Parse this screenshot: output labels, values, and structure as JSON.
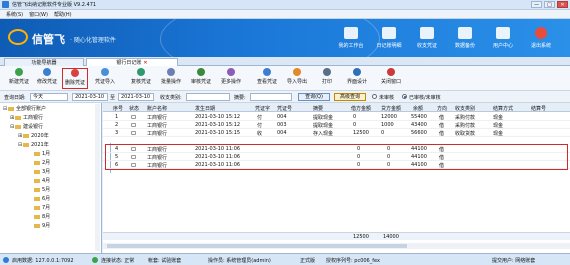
{
  "window": {
    "title": "信管飞出纳记账软件专业版 V9.2.471",
    "btn_min": "—",
    "btn_max": "□",
    "btn_close": "✕"
  },
  "menu": [
    "系统(S)",
    "窗口(W)",
    "帮助(H)"
  ],
  "banner": {
    "brand": "信管飞",
    "slogan": "· 随心化管理软件",
    "buttons": [
      {
        "label": "我的工作台",
        "icon": "desk-icon"
      },
      {
        "label": "日记账明细",
        "icon": "ledger-icon"
      },
      {
        "label": "收支凭证",
        "icon": "voucher-icon"
      },
      {
        "label": "数据备份",
        "icon": "backup-icon"
      },
      {
        "label": "用户中心",
        "icon": "user-icon"
      },
      {
        "label": "退出系统",
        "icon": "exit-icon"
      }
    ]
  },
  "tabs": [
    {
      "label": "功能导航器"
    },
    {
      "label": "银行日记账",
      "close": "✕"
    }
  ],
  "toolbar": [
    {
      "label": "新建凭证",
      "color": "#3aa24a"
    },
    {
      "label": "修改凭证",
      "color": "#3a7fd0"
    },
    {
      "label": "删除凭证",
      "color": "#d94040"
    },
    {
      "label": "凭证导入",
      "color": "#4a90d9"
    },
    {
      "label": "复核凭证",
      "color": "#2d9b6d"
    },
    {
      "label": "批量操作",
      "color": "#6d7fb0"
    },
    {
      "label": "审核凭证",
      "color": "#3a8a3a"
    },
    {
      "label": "更多操作",
      "color": "#8b5cb8"
    },
    {
      "label": "查看凭证",
      "color": "#3a7fd0"
    },
    {
      "label": "导入导出",
      "color": "#e08a2a"
    },
    {
      "label": "打印",
      "color": "#5a6e86"
    },
    {
      "label": "界面设计",
      "color": "#2f6fba"
    },
    {
      "label": "关闭窗口",
      "color": "#c93a3a"
    }
  ],
  "filter": {
    "period_label": "查询日期:",
    "period_value": "今天",
    "date_from": "2021-03-10",
    "date_sep": "至",
    "date_to": "2021-03-10",
    "category_label": "收支类别:",
    "category_value": "",
    "summary_label": "摘要:",
    "summary_value": "",
    "query_btn": "查询(Q)",
    "advanced_btn": "高级查询",
    "radio_unreviewed": "未审核",
    "radio_all": "已审核/未审核"
  },
  "tree": {
    "root": "全部银行账户",
    "bank1": "工商银行",
    "bank2": "建设银行",
    "y2020": "2020年",
    "y2021": "2021年",
    "months": [
      "1月",
      "2月",
      "3月",
      "4月",
      "5月",
      "6月",
      "7月",
      "8月",
      "9月"
    ]
  },
  "grid": {
    "headers": [
      "序号",
      "状态",
      "账户名称",
      "发生日期",
      "凭证字",
      "凭证号",
      "摘要",
      "借方金额",
      "贷方金额",
      "余额",
      "方向",
      "收支类别",
      "结算方式",
      "结算号"
    ],
    "rows": [
      [
        "1",
        "",
        "工商银行",
        "2021-03-10 15:12",
        "付",
        "004",
        "提取现金",
        "0",
        "12000",
        "55400",
        "借",
        "采购付款",
        "现金",
        ""
      ],
      [
        "2",
        "",
        "工商银行",
        "2021-03-10 15:12",
        "付",
        "003",
        "提取现金",
        "0",
        "1000",
        "43400",
        "借",
        "采购付款",
        "现金",
        ""
      ],
      [
        "3",
        "",
        "工商银行",
        "2021-03-10 15:15",
        "收",
        "004",
        "存入现金",
        "12500",
        "0",
        "56600",
        "借",
        "收取货款",
        "现金",
        ""
      ],
      [
        "4",
        "",
        "工商银行",
        "2021-03-10 11:06",
        "",
        "",
        "",
        "0",
        "0",
        "44100",
        "借",
        "",
        "",
        ""
      ],
      [
        "5",
        "",
        "工商银行",
        "2021-03-10 11:06",
        "",
        "",
        "",
        "0",
        "0",
        "44100",
        "借",
        "",
        "",
        ""
      ],
      [
        "6",
        "",
        "工商银行",
        "2021-03-10 11:06",
        "",
        "",
        "",
        "0",
        "0",
        "44100",
        "借",
        "",
        "",
        ""
      ]
    ],
    "total_debit": "12500",
    "total_credit": "14000"
  },
  "status": {
    "server": "启用数据: 127.0.0.1:7092",
    "conn": "连接状态: 正常",
    "account": "帐套: 试验账套",
    "user": "操作员: 系统管理员(admin)",
    "edition": "正式版",
    "license": "授权序列号: pc006_fex",
    "right": "提交用户: 网络账套"
  }
}
